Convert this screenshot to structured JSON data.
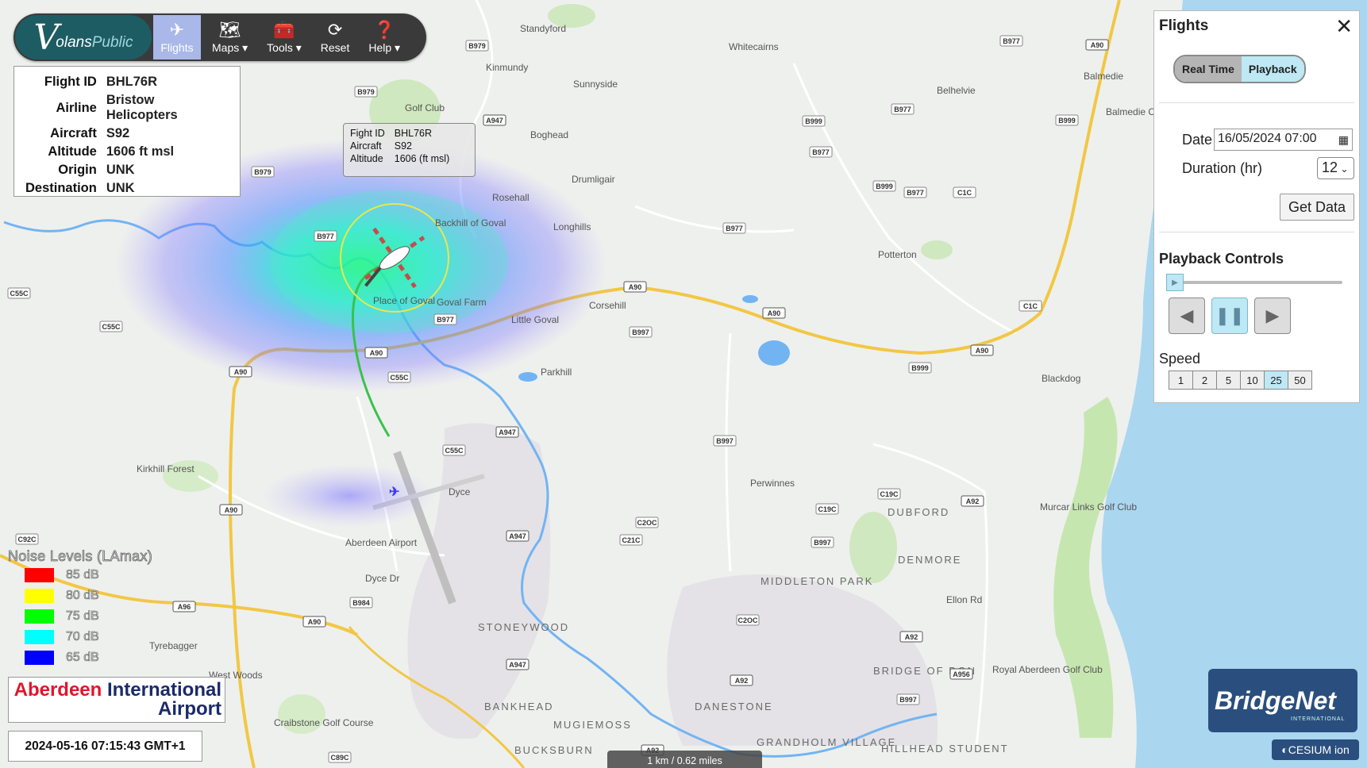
{
  "toolbar": {
    "logo_v": "V",
    "logo_text_a": "olans",
    "logo_text_b": "Public",
    "buttons": [
      {
        "label": "Flights",
        "icon": "airplane-icon"
      },
      {
        "label": "Maps ▾",
        "icon": "map-icon"
      },
      {
        "label": "Tools ▾",
        "icon": "toolbox-icon"
      },
      {
        "label": "Reset",
        "icon": "refresh-icon"
      },
      {
        "label": "Help ▾",
        "icon": "help-icon"
      }
    ]
  },
  "flight_info": {
    "rows": [
      {
        "key": "Flight ID",
        "value": "BHL76R"
      },
      {
        "key": "Airline",
        "value": "Bristow Helicopters"
      },
      {
        "key": "Aircraft",
        "value": "S92"
      },
      {
        "key": "Altitude",
        "value": "1606 ft msl"
      },
      {
        "key": "Origin",
        "value": "UNK"
      },
      {
        "key": "Destination",
        "value": "UNK"
      }
    ]
  },
  "popup": {
    "rows": [
      {
        "key": "Fight ID",
        "value": "BHL76R"
      },
      {
        "key": "Aircraft",
        "value": "S92"
      },
      {
        "key": "Altitude",
        "value": "1606  (ft msl)"
      }
    ]
  },
  "panel": {
    "title": "Flights",
    "close": "✕",
    "mode_realtime": "Real Time",
    "mode_playback": "Playback",
    "date_label": "Date",
    "date_value": "16/05/2024 07:00",
    "duration_label": "Duration (hr)",
    "duration_value": "12",
    "get_data": "Get Data",
    "playback_title": "Playback Controls",
    "speed_label": "Speed",
    "speeds": [
      "1",
      "2",
      "5",
      "10",
      "25",
      "50"
    ],
    "speed_selected": "25"
  },
  "noise_legend": {
    "title": "Noise Levels (LAmax)",
    "levels": [
      {
        "label": "85 dB",
        "color": "#ff0000"
      },
      {
        "label": "80 dB",
        "color": "#ffff00"
      },
      {
        "label": "75 dB",
        "color": "#00ff00"
      },
      {
        "label": "70 dB",
        "color": "#00ffff"
      },
      {
        "label": "65 dB",
        "color": "#0000ff"
      }
    ]
  },
  "airport_logo": {
    "red": "Aberdeen",
    "blue": " International",
    "line2": "Airport"
  },
  "timestamp": "2024-05-16 07:15:43 GMT+1",
  "bridgenet": {
    "name": "BridgeNet",
    "sub": "INTERNATIONAL"
  },
  "cesium": "CESIUM ion",
  "scalebar": "1 km / 0.62 miles",
  "map_labels": {
    "places": [
      "Standyford",
      "Whitecairns",
      "Kinmundy",
      "Sunnyside",
      "Belhelvie",
      "Balmedie",
      "Boghead",
      "Drumligair",
      "Rosehall",
      "Backhill of Goval",
      "Longhills",
      "Potterton",
      "Goval Farm",
      "Place of Goval",
      "Corsehill",
      "Little Goval",
      "Parkhill",
      "Blackdog",
      "Kirkhill Forest",
      "Dyce",
      "Aberdeen Airport",
      "Perwinnes",
      "Murcar Links Golf Club",
      "Tyrebagger",
      "West Woods",
      "Craibstone Golf Course",
      "Royal Aberdeen Golf Club",
      "Dyce Dr",
      "Golf Club",
      "Ellon Rd",
      "Balmedie Country Park"
    ],
    "districts": [
      "DUBFORD",
      "DENMORE",
      "MIDDLETON PARK",
      "STONEYWOOD",
      "BRIDGE OF DON",
      "BANKHEAD",
      "DANESTONE",
      "MUGIEMOSS",
      "GRANDHOLM VILLAGE",
      "BUCKSBURN",
      "HILLHEAD STUDENT"
    ],
    "roads": [
      "B979",
      "B977",
      "A90",
      "B999",
      "A947",
      "C1C",
      "B997",
      "C55C",
      "C2OC",
      "C21C",
      "A96",
      "B984",
      "A92",
      "A956",
      "C19C",
      "C92C",
      "C89C"
    ]
  },
  "colors": {
    "accent": "#a9b8e8",
    "toolbar": "#3a3a3a",
    "logo_bg": "#1e5c64",
    "playback": "#bde8f4",
    "road_major": "#f2c744",
    "flight_track": "#39c24a"
  }
}
